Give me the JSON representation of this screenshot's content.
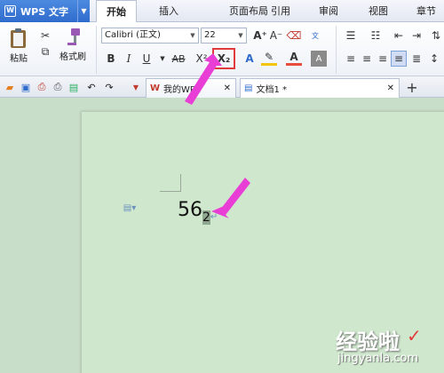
{
  "app": {
    "name": "WPS 文字"
  },
  "ribbon_tabs": [
    "开始",
    "插入",
    "页面布局",
    "引用",
    "审阅",
    "视图",
    "章节"
  ],
  "active_tab": "开始",
  "clipboard": {
    "paste_label": "粘贴",
    "format_painter_label": "格式刷"
  },
  "font": {
    "family": "Calibri (正文)",
    "size": "22"
  },
  "doc_tabs": [
    {
      "label": "我的WPS"
    },
    {
      "label": "文档1 *"
    }
  ],
  "document": {
    "text_main": "56",
    "text_sub": "2"
  },
  "watermark": {
    "line1": "经验啦",
    "line2": "jingyanla.com"
  },
  "colors": {
    "accent": "#2f6ccc",
    "highlight": "#e23a3a",
    "arrow": "#e83ed6",
    "page": "#cfe8cd"
  }
}
